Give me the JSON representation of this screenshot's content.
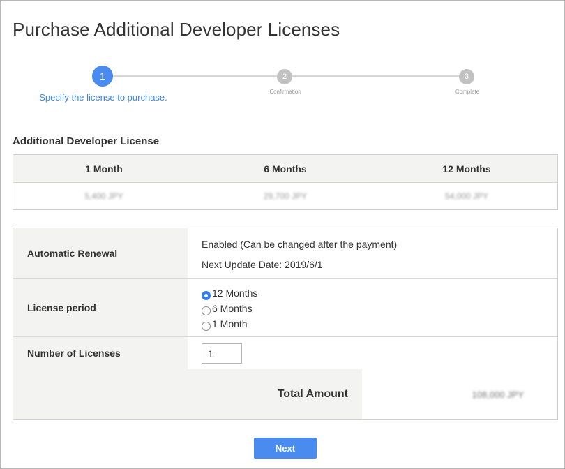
{
  "page": {
    "title": "Purchase Additional Developer Licenses"
  },
  "stepper": {
    "steps": [
      {
        "number": "1",
        "label": "Specify the license to purchase.",
        "active": true
      },
      {
        "number": "2",
        "label": "Confirmation",
        "active": false
      },
      {
        "number": "3",
        "label": "Complete",
        "active": false
      }
    ]
  },
  "license_section": {
    "title": "Additional Developer License",
    "columns": [
      "1 Month",
      "6 Months",
      "12 Months"
    ],
    "prices": [
      "5,400 JPY",
      "29,700 JPY",
      "54,000 JPY"
    ]
  },
  "form": {
    "auto_renewal": {
      "label": "Automatic Renewal",
      "status": "Enabled (Can be changed after the payment)",
      "next_update": "Next Update Date: 2019/6/1"
    },
    "license_period": {
      "label": "License period",
      "options": [
        "12 Months",
        "6 Months",
        "1 Month"
      ],
      "selected": "12 Months"
    },
    "number_of_licenses": {
      "label": "Number of Licenses",
      "value": "1"
    },
    "total": {
      "label": "Total Amount",
      "value": "108,000 JPY"
    }
  },
  "actions": {
    "next_label": "Next"
  },
  "colors": {
    "accent": "#4a8bf0",
    "inactive_step": "#c2c2c2",
    "label_bg": "#f3f3f1"
  }
}
